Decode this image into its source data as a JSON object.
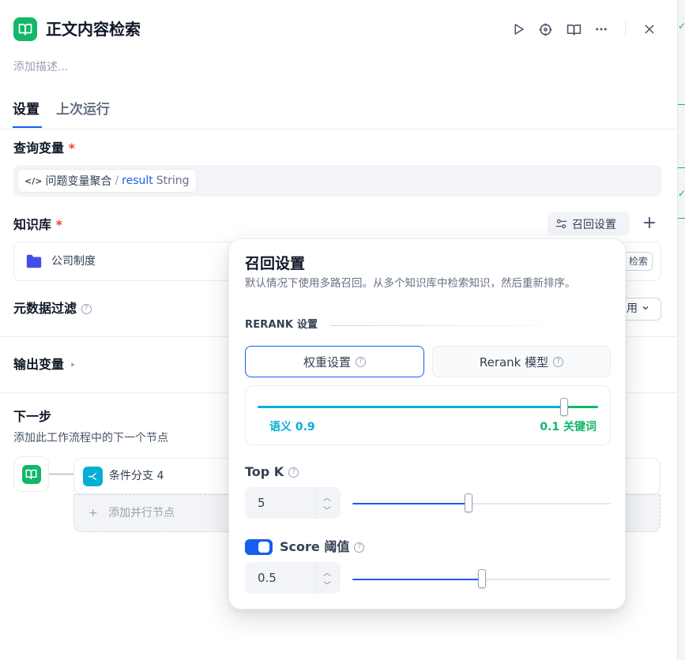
{
  "header": {
    "title": "正文内容检索",
    "description_placeholder": "添加描述..."
  },
  "tabs": [
    {
      "label": "设置",
      "active": true
    },
    {
      "label": "上次运行",
      "active": false
    }
  ],
  "query_variable": {
    "label": "查询变量",
    "required_mark": "*",
    "node": "问题变量聚合",
    "separator": "/",
    "var_name": "result",
    "var_type": "String"
  },
  "knowledge": {
    "label": "知识库",
    "required_mark": "*",
    "recall_button": "召回设置",
    "items": [
      {
        "name": "公司制度",
        "tag": "检索"
      }
    ]
  },
  "metadata_filter": {
    "label": "元数据过滤",
    "select_value": "用"
  },
  "output_vars": {
    "label": "输出变量"
  },
  "next_step": {
    "label": "下一步",
    "subtitle": "添加此工作流程中的下一个节点",
    "branch_name": "条件分支 4",
    "add_parallel": "添加并行节点"
  },
  "recall_popover": {
    "title": "召回设置",
    "description": "默认情况下使用多路召回。从多个知识库中检索知识，然后重新排序。",
    "rerank_heading": "RERANK 设置",
    "mode_weight": "权重设置",
    "mode_rerank": "Rerank 模型",
    "semantic_label": "语义 0.9",
    "keyword_label": "0.1 关键词",
    "semantic_weight": 0.9,
    "top_k_label": "Top K",
    "top_k_value": "5",
    "top_k_fraction": 0.45,
    "score_label": "Score 阈值",
    "score_enabled": true,
    "score_value": "0.5",
    "score_fraction": 0.5
  },
  "colors": {
    "accent": "#155eef",
    "node_green": "#12b76a",
    "branch_cyan": "#06aed4",
    "required_red": "#f04438"
  }
}
